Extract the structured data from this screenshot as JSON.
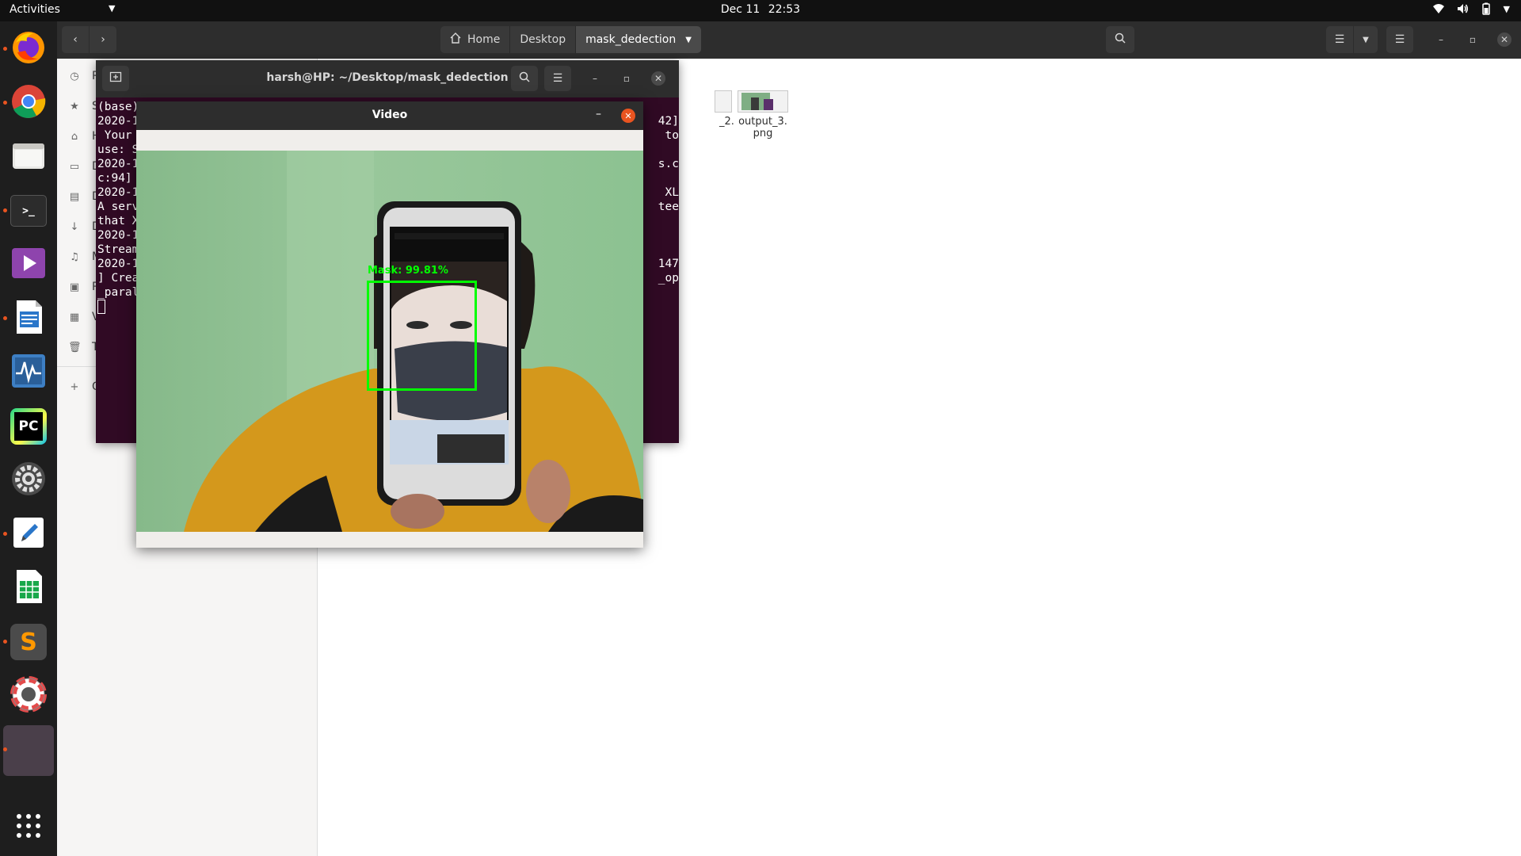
{
  "topbar": {
    "activities": "Activities",
    "date": "Dec 11",
    "time": "22:53"
  },
  "dock": {
    "items": [
      {
        "name": "firefox",
        "icon": "firefox-icon",
        "running": true
      },
      {
        "name": "chrome",
        "icon": "chrome-icon",
        "running": true
      },
      {
        "name": "files",
        "icon": "folder-icon",
        "running": false
      },
      {
        "name": "terminal",
        "icon": "terminal-icon",
        "running": true,
        "label": ">_"
      },
      {
        "name": "videos",
        "icon": "play-icon",
        "running": false
      },
      {
        "name": "writer",
        "icon": "document-icon",
        "running": true
      },
      {
        "name": "system-monitor",
        "icon": "monitor-icon",
        "running": false
      },
      {
        "name": "pycharm",
        "icon": "pycharm-icon",
        "running": false,
        "label": "PC"
      },
      {
        "name": "settings",
        "icon": "gear-icon",
        "running": false
      },
      {
        "name": "text-editor",
        "icon": "pencil-icon",
        "running": true
      },
      {
        "name": "calc",
        "icon": "spreadsheet-icon",
        "running": false
      },
      {
        "name": "sublime",
        "icon": "sublime-icon",
        "running": true,
        "label": "S"
      },
      {
        "name": "help",
        "icon": "lifebuoy-icon",
        "running": false
      },
      {
        "name": "active-window",
        "icon": "blank-window-icon",
        "running": true
      }
    ],
    "show_apps_icon": "grid-icon"
  },
  "nautilus": {
    "breadcrumbs": [
      "Home",
      "Desktop",
      "mask_dedection"
    ],
    "sidebar": [
      {
        "label": "R",
        "icon": "recent-icon"
      },
      {
        "label": "S",
        "icon": "star-icon"
      },
      {
        "label": "H",
        "icon": "home-icon"
      },
      {
        "label": "D",
        "icon": "desktop-icon"
      },
      {
        "label": "D",
        "icon": "documents-icon"
      },
      {
        "label": "D",
        "icon": "downloads-icon"
      },
      {
        "label": "M",
        "icon": "music-icon"
      },
      {
        "label": "P",
        "icon": "pictures-icon"
      },
      {
        "label": "V",
        "icon": "videos-icon"
      },
      {
        "label": "T",
        "icon": "trash-icon"
      },
      {
        "label": "O",
        "icon": "plus-icon"
      }
    ],
    "files": [
      {
        "name_line1": "_2.",
        "name_line2": ""
      },
      {
        "name_line1": "output_3.",
        "name_line2": "png"
      }
    ]
  },
  "terminal": {
    "title": "harsh@HP: ~/Desktop/mask_dedection",
    "left_lines": [
      "(base)",
      "2020-1",
      " Your",
      "use: S",
      "2020-1",
      "c:94]",
      "2020-1",
      "A serv",
      "that X",
      "2020-1",
      "Stream",
      "2020-1",
      "] Crea",
      "_paral"
    ],
    "right_lines": [
      "",
      "42]",
      "to",
      "",
      "s.c",
      "",
      "XL",
      "tee",
      "",
      "",
      "",
      "147",
      "_op",
      ""
    ]
  },
  "video": {
    "title": "Video",
    "detection_label": "Mask: 99.81%",
    "colors": {
      "box": "#00ff00",
      "close": "#e95420"
    }
  }
}
